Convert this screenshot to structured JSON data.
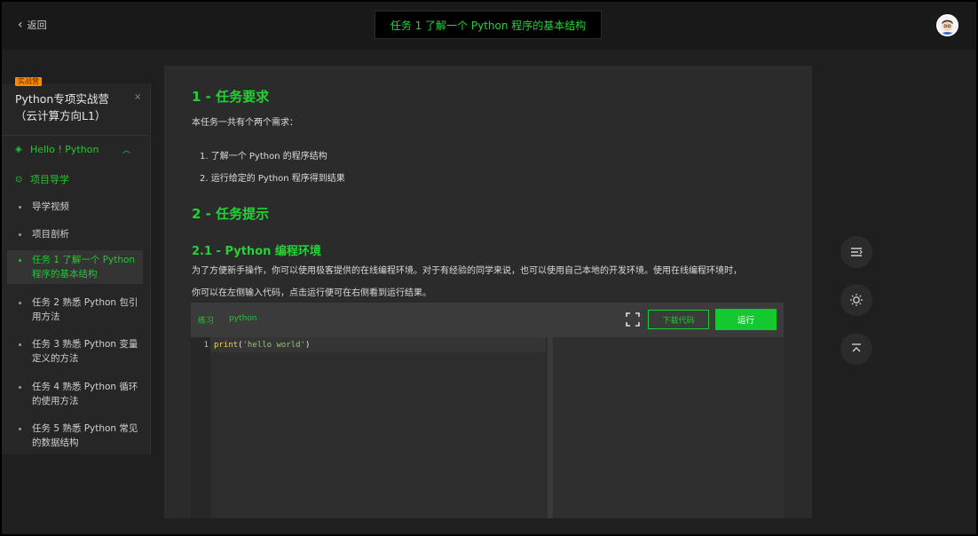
{
  "header": {
    "back_label": "返回",
    "task_title": "任务 1 了解一个 Python 程序的基本结构"
  },
  "sidebar": {
    "badge": "实战营",
    "camp_title": "Python专项实战营（云计算方向L1）",
    "close": "×",
    "section": {
      "label": "Hello ! Python",
      "expanded": true
    },
    "guide": {
      "label": "项目导学"
    },
    "items": [
      {
        "label": "导学视频",
        "active": false
      },
      {
        "label": "项目剖析",
        "active": false
      },
      {
        "label": "任务 1 了解一个 Python 程序的基本结构",
        "active": true
      },
      {
        "label": "任务 2 熟悉 Python 包引用方法",
        "active": false
      },
      {
        "label": "任务 3 熟悉 Python 变量定义的方法",
        "active": false
      },
      {
        "label": "任务 4 熟悉 Python 循环的使用方法",
        "active": false
      },
      {
        "label": "任务 5 熟悉 Python 常见的数据结构",
        "active": false
      }
    ]
  },
  "content": {
    "heading1": "1 - 任务要求",
    "intro": "本任务一共有个两个需求：",
    "list": [
      "1. 了解一个 Python 的程序结构",
      "2. 运行给定的 Python 程序得到结果"
    ],
    "heading2": "2 - 任务提示",
    "heading3": "2.1 - Python 编程环境",
    "para1": "为了方便新手操作，你可以使用极客提供的在线编程环境。对于有经验的同学来说，也可以使用自己本地的开发环境。使用在线编程环境时，",
    "para2": "你可以在左侧输入代码，点击运行便可在右侧看到运行结果。"
  },
  "editor": {
    "tab_label": "练习",
    "language": "python",
    "download_label": "下载代码",
    "run_label": "运行",
    "lines": [
      {
        "num": "1",
        "fn": "print",
        "open": "(",
        "str": "'hello world'",
        "close": ")"
      }
    ]
  },
  "colors": {
    "accent": "#22d334",
    "run_button": "#14c92f",
    "background": "#1f1f1f"
  },
  "tools": [
    "outline-icon",
    "theme-icon",
    "back-to-top-icon"
  ]
}
